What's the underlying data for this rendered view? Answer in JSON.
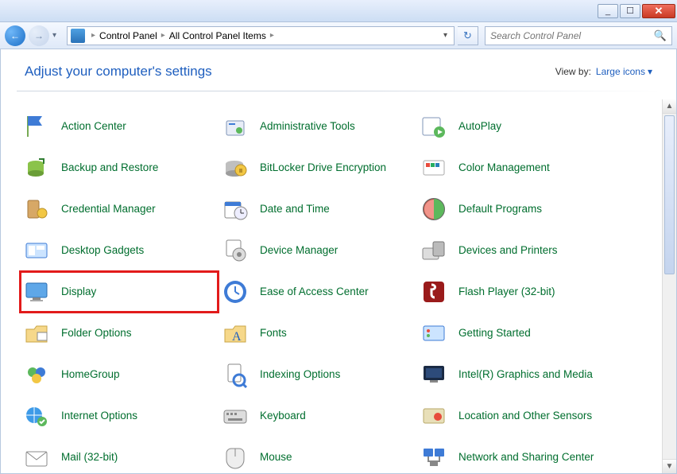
{
  "window": {
    "min_label": "_",
    "max_label": "☐",
    "close_label": "✕"
  },
  "nav": {
    "back_glyph": "←",
    "fwd_glyph": "→",
    "recent_glyph": "▾",
    "crumb1": "Control Panel",
    "crumb2": "All Control Panel Items",
    "sep_glyph": "▸",
    "dropdown_glyph": "▾",
    "refresh_glyph": "↻"
  },
  "search": {
    "placeholder": "Search Control Panel"
  },
  "header": {
    "title": "Adjust your computer's settings",
    "viewby_label": "View by:",
    "viewby_value": "Large icons",
    "viewby_caret": "▾"
  },
  "items": [
    {
      "label": "Action Center",
      "icon": "flag",
      "highlight": false
    },
    {
      "label": "Administrative Tools",
      "icon": "admin",
      "highlight": false
    },
    {
      "label": "AutoPlay",
      "icon": "autoplay",
      "highlight": false
    },
    {
      "label": "Backup and Restore",
      "icon": "backup",
      "highlight": false
    },
    {
      "label": "BitLocker Drive Encryption",
      "icon": "bitlocker",
      "highlight": false
    },
    {
      "label": "Color Management",
      "icon": "color",
      "highlight": false
    },
    {
      "label": "Credential Manager",
      "icon": "credential",
      "highlight": false
    },
    {
      "label": "Date and Time",
      "icon": "datetime",
      "highlight": false
    },
    {
      "label": "Default Programs",
      "icon": "defaults",
      "highlight": false
    },
    {
      "label": "Desktop Gadgets",
      "icon": "gadgets",
      "highlight": false
    },
    {
      "label": "Device Manager",
      "icon": "devmgr",
      "highlight": false
    },
    {
      "label": "Devices and Printers",
      "icon": "devices",
      "highlight": false
    },
    {
      "label": "Display",
      "icon": "display",
      "highlight": true
    },
    {
      "label": "Ease of Access Center",
      "icon": "ease",
      "highlight": false
    },
    {
      "label": "Flash Player (32-bit)",
      "icon": "flash",
      "highlight": false
    },
    {
      "label": "Folder Options",
      "icon": "folderopt",
      "highlight": false
    },
    {
      "label": "Fonts",
      "icon": "fonts",
      "highlight": false
    },
    {
      "label": "Getting Started",
      "icon": "getstart",
      "highlight": false
    },
    {
      "label": "HomeGroup",
      "icon": "homegroup",
      "highlight": false
    },
    {
      "label": "Indexing Options",
      "icon": "indexing",
      "highlight": false
    },
    {
      "label": "Intel(R) Graphics and Media",
      "icon": "intel",
      "highlight": false
    },
    {
      "label": "Internet Options",
      "icon": "inet",
      "highlight": false
    },
    {
      "label": "Keyboard",
      "icon": "keyboard",
      "highlight": false
    },
    {
      "label": "Location and Other Sensors",
      "icon": "location",
      "highlight": false
    },
    {
      "label": "Mail (32-bit)",
      "icon": "mail",
      "highlight": false
    },
    {
      "label": "Mouse",
      "icon": "mouse",
      "highlight": false
    },
    {
      "label": "Network and Sharing Center",
      "icon": "network",
      "highlight": false
    }
  ]
}
